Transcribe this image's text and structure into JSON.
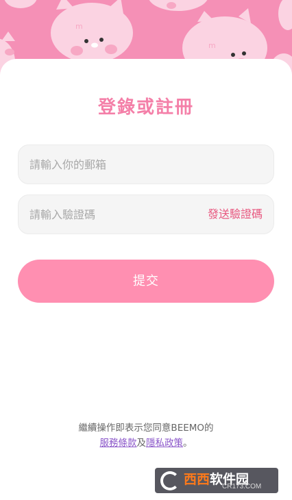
{
  "header": {
    "title": "登錄或註冊"
  },
  "form": {
    "email_placeholder": "請輸入你的郵箱",
    "code_placeholder": "請輸入驗證碼",
    "send_code_label": "發送驗證碼",
    "submit_label": "提交"
  },
  "footer": {
    "notice_text": "繼續操作即表示您同意BEEMO的",
    "terms_link": "服務條款",
    "conjunction": "及",
    "privacy_link": "隱私政策",
    "period": "。"
  },
  "watermark": {
    "brand_part1": "西西",
    "brand_part2": "软件园",
    "domain": "CR173.COM"
  },
  "colors": {
    "banner": "#f590b6",
    "accent": "#f47fa8",
    "button": "#ff8fb1",
    "link": "#8a55c9"
  },
  "icons": [
    "pig-face-pattern",
    "site-logo-icon"
  ]
}
